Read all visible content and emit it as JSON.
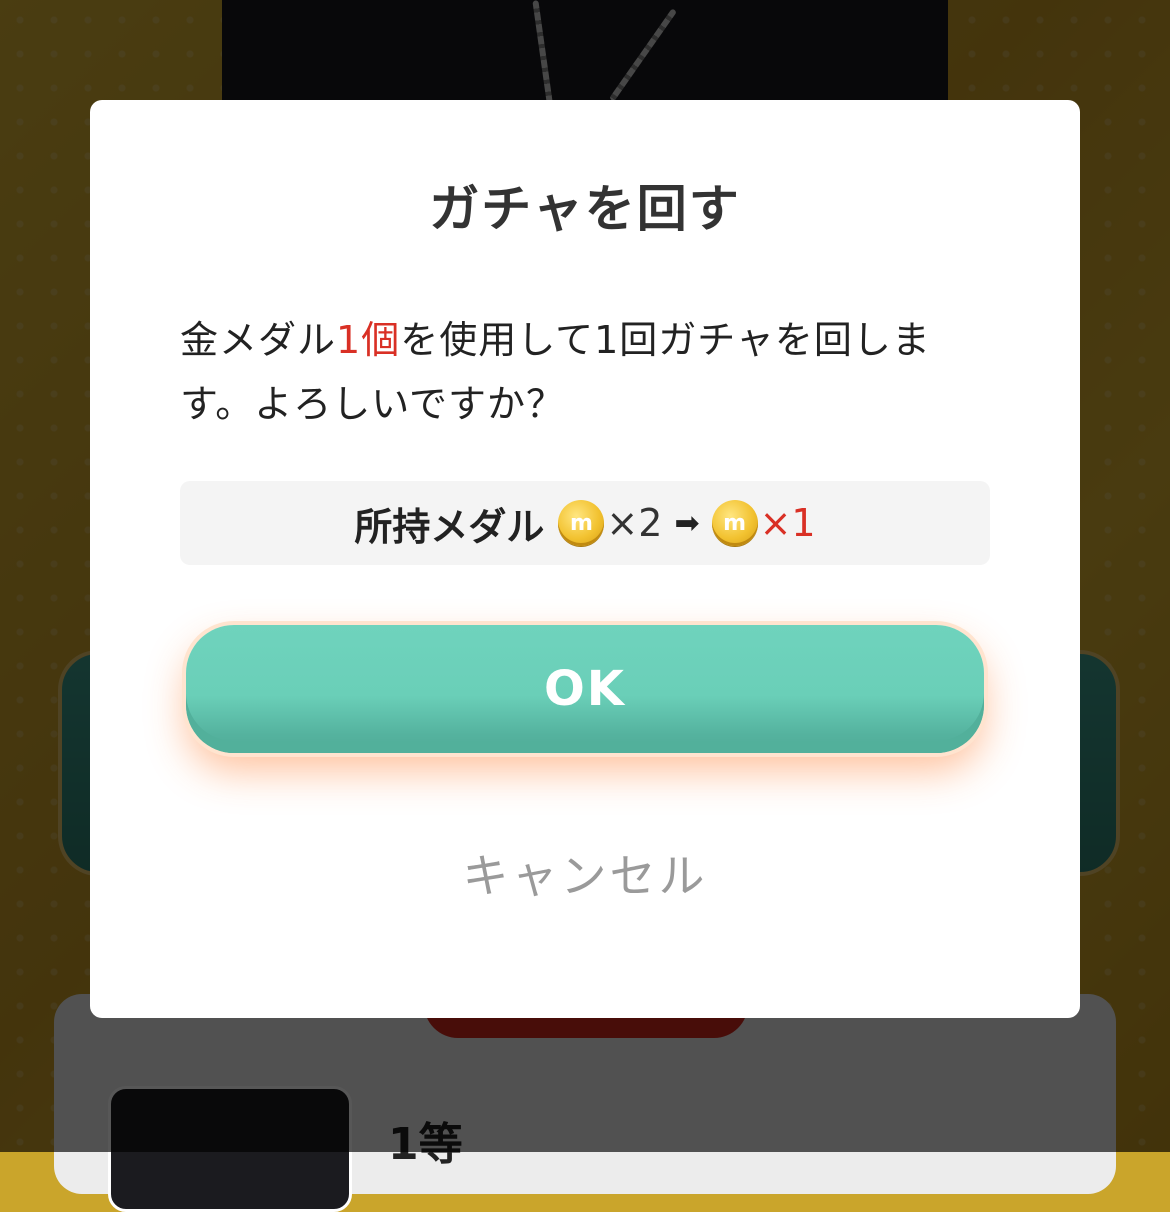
{
  "background": {
    "prize_rank": "1等"
  },
  "dialog": {
    "title": "ガチャを回す",
    "message_prefix": "金メダル",
    "message_quantity": "1個",
    "message_suffix": "を使用して1回ガチャを回します。よろしいですか？",
    "summary_label": "所持メダル",
    "coin_icon_letter": "ⓜ",
    "current_count": "×2",
    "arrow": "➡",
    "new_count": "×1",
    "ok_label": "OK",
    "cancel_label": "キャンセル"
  },
  "colors": {
    "accent_red": "#d93025",
    "ok_button": "#6acfb8",
    "coin_gold": "#f2c230"
  }
}
